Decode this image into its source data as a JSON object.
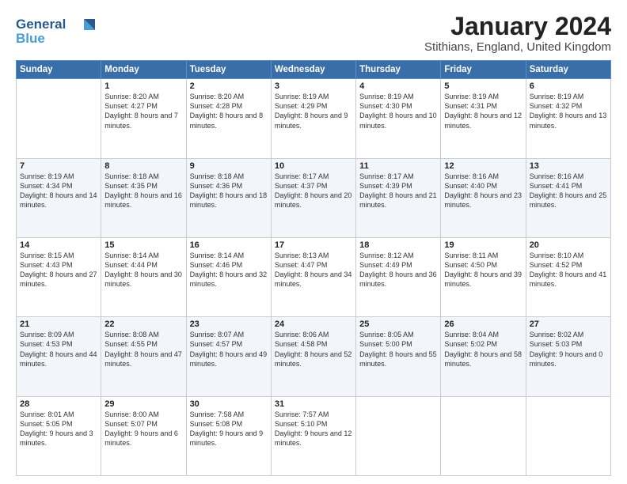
{
  "logo": {
    "line1": "General",
    "line2": "Blue"
  },
  "title": "January 2024",
  "subtitle": "Stithians, England, United Kingdom",
  "weekdays": [
    "Sunday",
    "Monday",
    "Tuesday",
    "Wednesday",
    "Thursday",
    "Friday",
    "Saturday"
  ],
  "weeks": [
    [
      {
        "day": "",
        "sunrise": "",
        "sunset": "",
        "daylight": ""
      },
      {
        "day": "1",
        "sunrise": "Sunrise: 8:20 AM",
        "sunset": "Sunset: 4:27 PM",
        "daylight": "Daylight: 8 hours and 7 minutes."
      },
      {
        "day": "2",
        "sunrise": "Sunrise: 8:20 AM",
        "sunset": "Sunset: 4:28 PM",
        "daylight": "Daylight: 8 hours and 8 minutes."
      },
      {
        "day": "3",
        "sunrise": "Sunrise: 8:19 AM",
        "sunset": "Sunset: 4:29 PM",
        "daylight": "Daylight: 8 hours and 9 minutes."
      },
      {
        "day": "4",
        "sunrise": "Sunrise: 8:19 AM",
        "sunset": "Sunset: 4:30 PM",
        "daylight": "Daylight: 8 hours and 10 minutes."
      },
      {
        "day": "5",
        "sunrise": "Sunrise: 8:19 AM",
        "sunset": "Sunset: 4:31 PM",
        "daylight": "Daylight: 8 hours and 12 minutes."
      },
      {
        "day": "6",
        "sunrise": "Sunrise: 8:19 AM",
        "sunset": "Sunset: 4:32 PM",
        "daylight": "Daylight: 8 hours and 13 minutes."
      }
    ],
    [
      {
        "day": "7",
        "sunrise": "Sunrise: 8:19 AM",
        "sunset": "Sunset: 4:34 PM",
        "daylight": "Daylight: 8 hours and 14 minutes."
      },
      {
        "day": "8",
        "sunrise": "Sunrise: 8:18 AM",
        "sunset": "Sunset: 4:35 PM",
        "daylight": "Daylight: 8 hours and 16 minutes."
      },
      {
        "day": "9",
        "sunrise": "Sunrise: 8:18 AM",
        "sunset": "Sunset: 4:36 PM",
        "daylight": "Daylight: 8 hours and 18 minutes."
      },
      {
        "day": "10",
        "sunrise": "Sunrise: 8:17 AM",
        "sunset": "Sunset: 4:37 PM",
        "daylight": "Daylight: 8 hours and 20 minutes."
      },
      {
        "day": "11",
        "sunrise": "Sunrise: 8:17 AM",
        "sunset": "Sunset: 4:39 PM",
        "daylight": "Daylight: 8 hours and 21 minutes."
      },
      {
        "day": "12",
        "sunrise": "Sunrise: 8:16 AM",
        "sunset": "Sunset: 4:40 PM",
        "daylight": "Daylight: 8 hours and 23 minutes."
      },
      {
        "day": "13",
        "sunrise": "Sunrise: 8:16 AM",
        "sunset": "Sunset: 4:41 PM",
        "daylight": "Daylight: 8 hours and 25 minutes."
      }
    ],
    [
      {
        "day": "14",
        "sunrise": "Sunrise: 8:15 AM",
        "sunset": "Sunset: 4:43 PM",
        "daylight": "Daylight: 8 hours and 27 minutes."
      },
      {
        "day": "15",
        "sunrise": "Sunrise: 8:14 AM",
        "sunset": "Sunset: 4:44 PM",
        "daylight": "Daylight: 8 hours and 30 minutes."
      },
      {
        "day": "16",
        "sunrise": "Sunrise: 8:14 AM",
        "sunset": "Sunset: 4:46 PM",
        "daylight": "Daylight: 8 hours and 32 minutes."
      },
      {
        "day": "17",
        "sunrise": "Sunrise: 8:13 AM",
        "sunset": "Sunset: 4:47 PM",
        "daylight": "Daylight: 8 hours and 34 minutes."
      },
      {
        "day": "18",
        "sunrise": "Sunrise: 8:12 AM",
        "sunset": "Sunset: 4:49 PM",
        "daylight": "Daylight: 8 hours and 36 minutes."
      },
      {
        "day": "19",
        "sunrise": "Sunrise: 8:11 AM",
        "sunset": "Sunset: 4:50 PM",
        "daylight": "Daylight: 8 hours and 39 minutes."
      },
      {
        "day": "20",
        "sunrise": "Sunrise: 8:10 AM",
        "sunset": "Sunset: 4:52 PM",
        "daylight": "Daylight: 8 hours and 41 minutes."
      }
    ],
    [
      {
        "day": "21",
        "sunrise": "Sunrise: 8:09 AM",
        "sunset": "Sunset: 4:53 PM",
        "daylight": "Daylight: 8 hours and 44 minutes."
      },
      {
        "day": "22",
        "sunrise": "Sunrise: 8:08 AM",
        "sunset": "Sunset: 4:55 PM",
        "daylight": "Daylight: 8 hours and 47 minutes."
      },
      {
        "day": "23",
        "sunrise": "Sunrise: 8:07 AM",
        "sunset": "Sunset: 4:57 PM",
        "daylight": "Daylight: 8 hours and 49 minutes."
      },
      {
        "day": "24",
        "sunrise": "Sunrise: 8:06 AM",
        "sunset": "Sunset: 4:58 PM",
        "daylight": "Daylight: 8 hours and 52 minutes."
      },
      {
        "day": "25",
        "sunrise": "Sunrise: 8:05 AM",
        "sunset": "Sunset: 5:00 PM",
        "daylight": "Daylight: 8 hours and 55 minutes."
      },
      {
        "day": "26",
        "sunrise": "Sunrise: 8:04 AM",
        "sunset": "Sunset: 5:02 PM",
        "daylight": "Daylight: 8 hours and 58 minutes."
      },
      {
        "day": "27",
        "sunrise": "Sunrise: 8:02 AM",
        "sunset": "Sunset: 5:03 PM",
        "daylight": "Daylight: 9 hours and 0 minutes."
      }
    ],
    [
      {
        "day": "28",
        "sunrise": "Sunrise: 8:01 AM",
        "sunset": "Sunset: 5:05 PM",
        "daylight": "Daylight: 9 hours and 3 minutes."
      },
      {
        "day": "29",
        "sunrise": "Sunrise: 8:00 AM",
        "sunset": "Sunset: 5:07 PM",
        "daylight": "Daylight: 9 hours and 6 minutes."
      },
      {
        "day": "30",
        "sunrise": "Sunrise: 7:58 AM",
        "sunset": "Sunset: 5:08 PM",
        "daylight": "Daylight: 9 hours and 9 minutes."
      },
      {
        "day": "31",
        "sunrise": "Sunrise: 7:57 AM",
        "sunset": "Sunset: 5:10 PM",
        "daylight": "Daylight: 9 hours and 12 minutes."
      },
      {
        "day": "",
        "sunrise": "",
        "sunset": "",
        "daylight": ""
      },
      {
        "day": "",
        "sunrise": "",
        "sunset": "",
        "daylight": ""
      },
      {
        "day": "",
        "sunrise": "",
        "sunset": "",
        "daylight": ""
      }
    ]
  ]
}
